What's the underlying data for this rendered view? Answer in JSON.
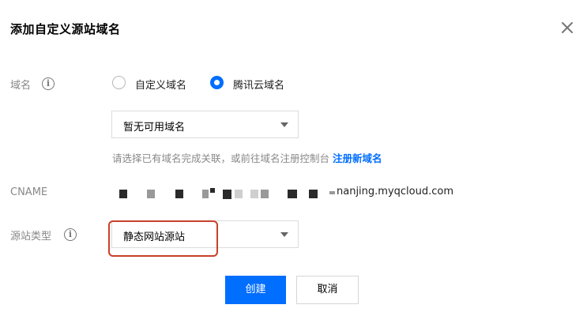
{
  "dialog": {
    "title": "添加自定义源站域名"
  },
  "domain_field": {
    "label": "域名",
    "options": [
      {
        "label": "自定义域名",
        "selected": false
      },
      {
        "label": "腾讯云域名",
        "selected": true
      }
    ],
    "select_value": "暂无可用域名",
    "hint_text": "请选择已有域名完成关联，或前往域名注册控制台",
    "hint_link": "注册新域名"
  },
  "cname_field": {
    "label": "CNAME",
    "value_suffix": "nanjing.myqcloud.com"
  },
  "origin_type_field": {
    "label": "源站类型",
    "select_value": "静态网站源站"
  },
  "buttons": {
    "create": "创建",
    "cancel": "取消"
  },
  "colors": {
    "primary": "#006eff",
    "highlight_border": "#c8402a"
  }
}
